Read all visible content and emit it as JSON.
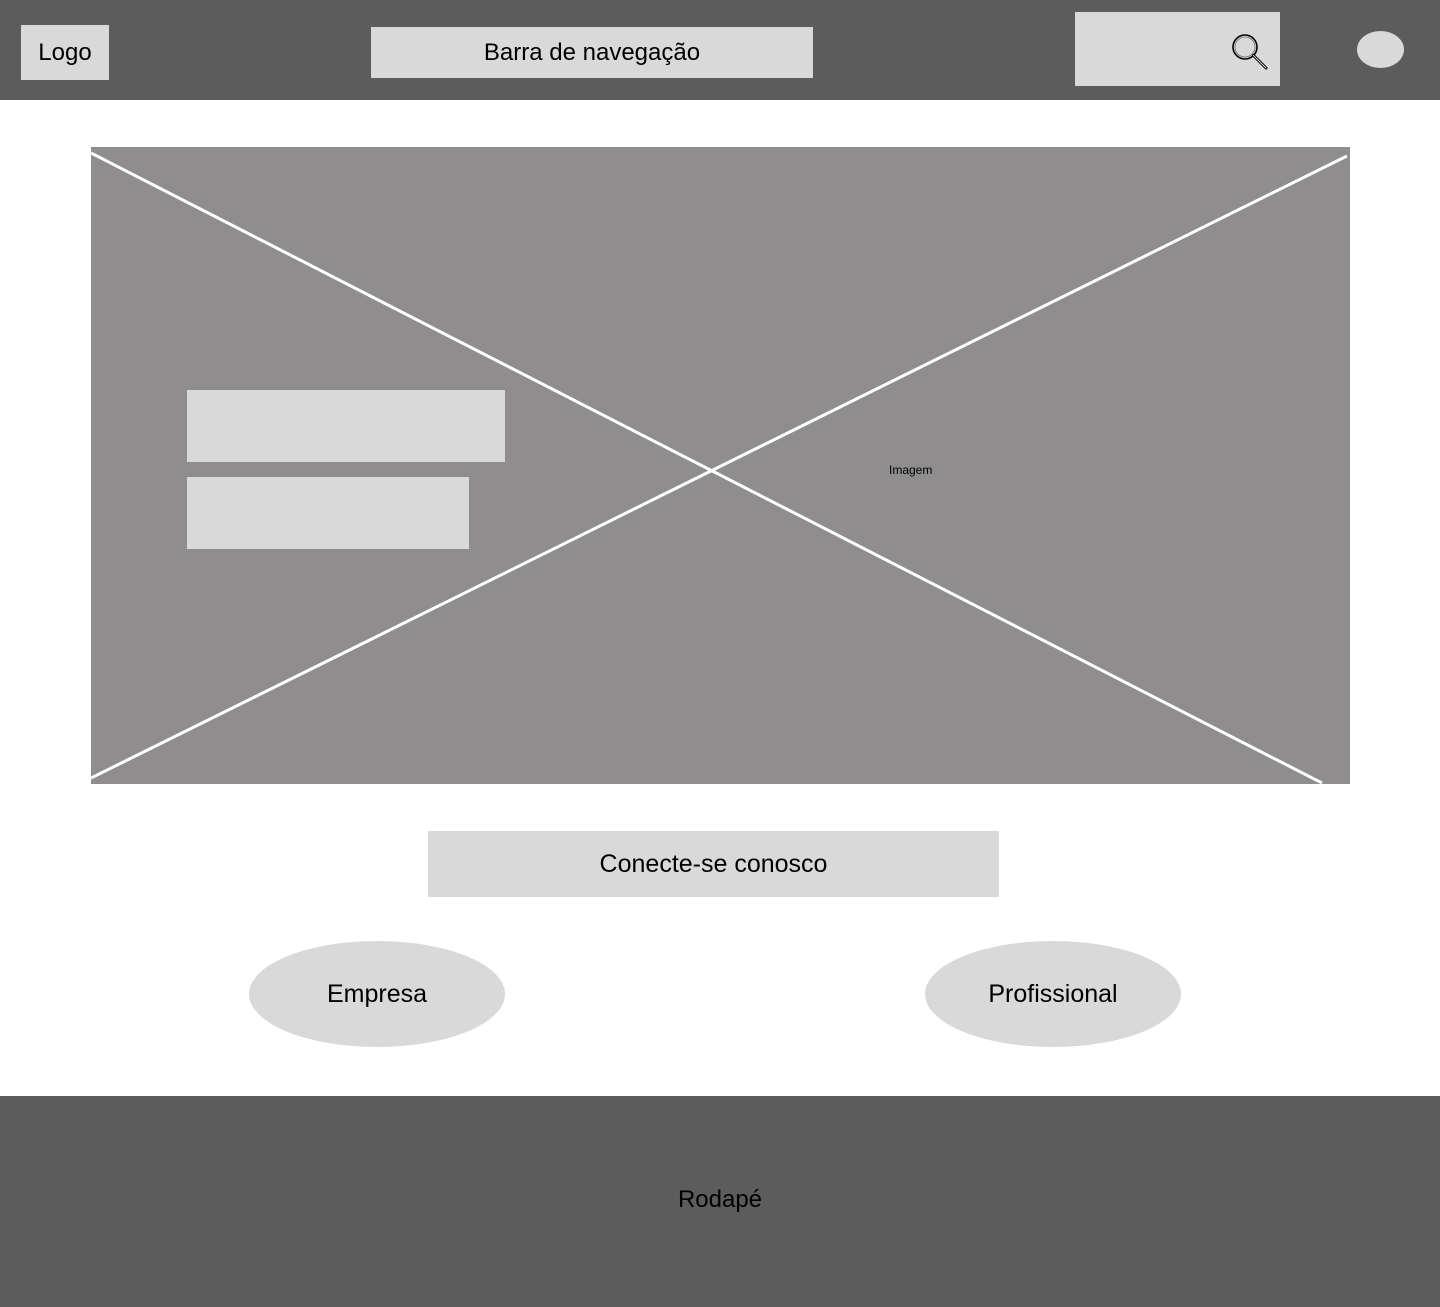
{
  "header": {
    "logo": "Logo",
    "nav": "Barra de navegação",
    "search_icon": "search-icon",
    "avatar_icon": "avatar-circle"
  },
  "hero": {
    "image_label": "Imagem",
    "placeholder_icon": "image-placeholder-cross"
  },
  "cta": {
    "label": "Conecte-se conosco"
  },
  "options": {
    "company": "Empresa",
    "professional": "Profissional"
  },
  "footer": {
    "label": "Rodapé"
  },
  "colors": {
    "header_bg": "#5c5c5c",
    "placeholder": "#d9d9d9",
    "image_bg": "#8f8d8e",
    "footer_bg": "#5c5c5c"
  }
}
